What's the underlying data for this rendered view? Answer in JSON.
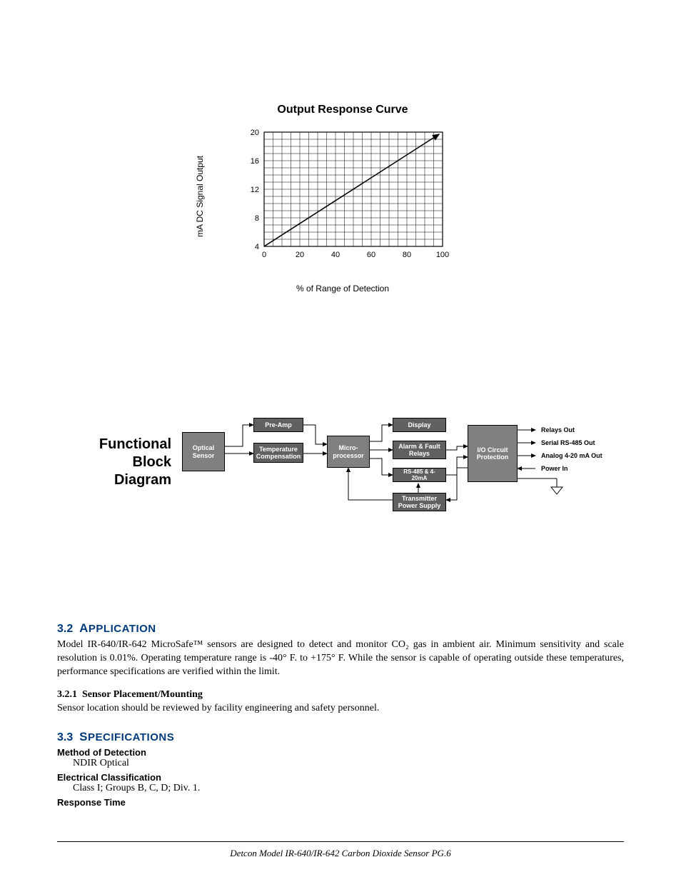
{
  "chart_data": {
    "type": "line",
    "title": "Output Response Curve",
    "xlabel": "% of Range of Detection",
    "ylabel": "mA DC Signal Output",
    "xlim": [
      0,
      100
    ],
    "ylim": [
      4,
      20
    ],
    "xticks": [
      0,
      20,
      40,
      60,
      80,
      100
    ],
    "yticks": [
      4,
      8,
      12,
      16,
      20
    ],
    "series": [
      {
        "name": "output",
        "x": [
          0,
          100
        ],
        "y": [
          4,
          20
        ]
      }
    ]
  },
  "diagram": {
    "title_lines": [
      "Functional",
      "Block",
      "Diagram"
    ],
    "blocks": {
      "optical_sensor": "Optical Sensor",
      "pre_amp": "Pre-Amp",
      "temp_comp": "Temperature Compensation",
      "micro": "Micro-processor",
      "display": "Display",
      "alarm": "Alarm & Fault Relays",
      "rs485": "RS-485 & 4-20mA",
      "tx_ps": "Transmitter Power Supply",
      "io": "I/O Circuit Protection"
    },
    "outputs": {
      "relays": "Relays Out",
      "serial": "Serial RS-485 Out",
      "analog": "Analog 4-20 mA Out",
      "power": "Power In"
    }
  },
  "sections": {
    "s32_num": "3.2",
    "s32_title": "Application",
    "s32_body": "Model IR-640/IR-642 MicroSafe™ sensors are designed to detect and monitor CO₂ gas in ambient air. Minimum sensitivity and scale resolution is 0.01%. Operating temperature range is -40° F. to +175° F. While the sensor is capable of operating outside these temperatures, performance specifications are verified within the limit.",
    "s321_num": "3.2.1",
    "s321_title": "Sensor Placement/Mounting",
    "s321_body": "Sensor location should be reviewed by facility engineering and safety personnel.",
    "s33_num": "3.3",
    "s33_title": "Specifications",
    "specs": {
      "method_label": "Method of Detection",
      "method_value": "NDIR Optical",
      "elec_label": "Electrical Classification",
      "elec_value": "Class I; Groups B, C, D; Div. 1.",
      "resp_label": "Response Time"
    }
  },
  "footer": "Detcon Model IR-640/IR-642 Carbon Dioxide Sensor  PG.6"
}
